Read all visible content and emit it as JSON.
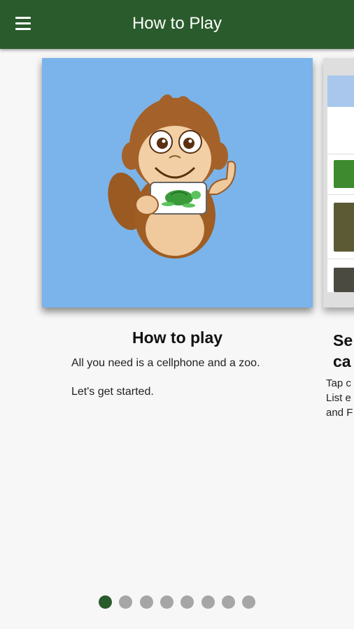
{
  "header": {
    "title": "How to Play",
    "menu_icon": "hamburger-menu-icon"
  },
  "cards": [
    {
      "title": "How to play",
      "lines": [
        "All you need is a cellphone and a zoo.",
        "Let's get started."
      ]
    },
    {
      "title_lines": [
        "Se",
        "ca"
      ],
      "text_lines": [
        "Tap c",
        "List e",
        "and F"
      ]
    }
  ],
  "pager": {
    "total": 8,
    "current": 1
  },
  "colors": {
    "appbar": "#2a5b2c",
    "card_bg": "#7ab4ea",
    "dot_active": "#2a5b2c",
    "dot_inactive": "#a6a6a6"
  }
}
